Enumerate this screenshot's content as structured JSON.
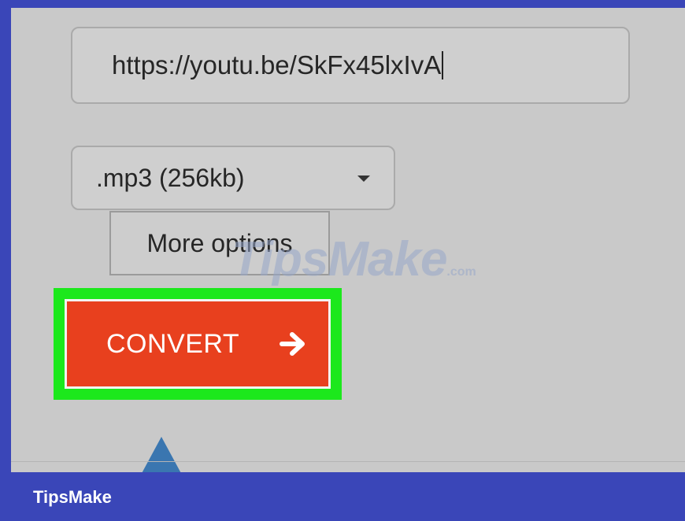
{
  "url_input": {
    "value": "https://youtu.be/SkFx45lxIvA"
  },
  "format_select": {
    "selected": ".mp3 (256kb)",
    "icon": "chevron-down-icon"
  },
  "more_options": {
    "label": "More options"
  },
  "watermark": {
    "text": "TipsMake",
    "suffix": ".com"
  },
  "convert": {
    "label": "CONVERT",
    "icon": "arrow-right-icon"
  },
  "footer": {
    "brand": "TipsMake"
  },
  "colors": {
    "frame": "#3a46b8",
    "panel": "#c9c9c9",
    "highlight": "#1ce81c",
    "convert_button": "#e8401e",
    "pointer": "#3a76b0"
  }
}
